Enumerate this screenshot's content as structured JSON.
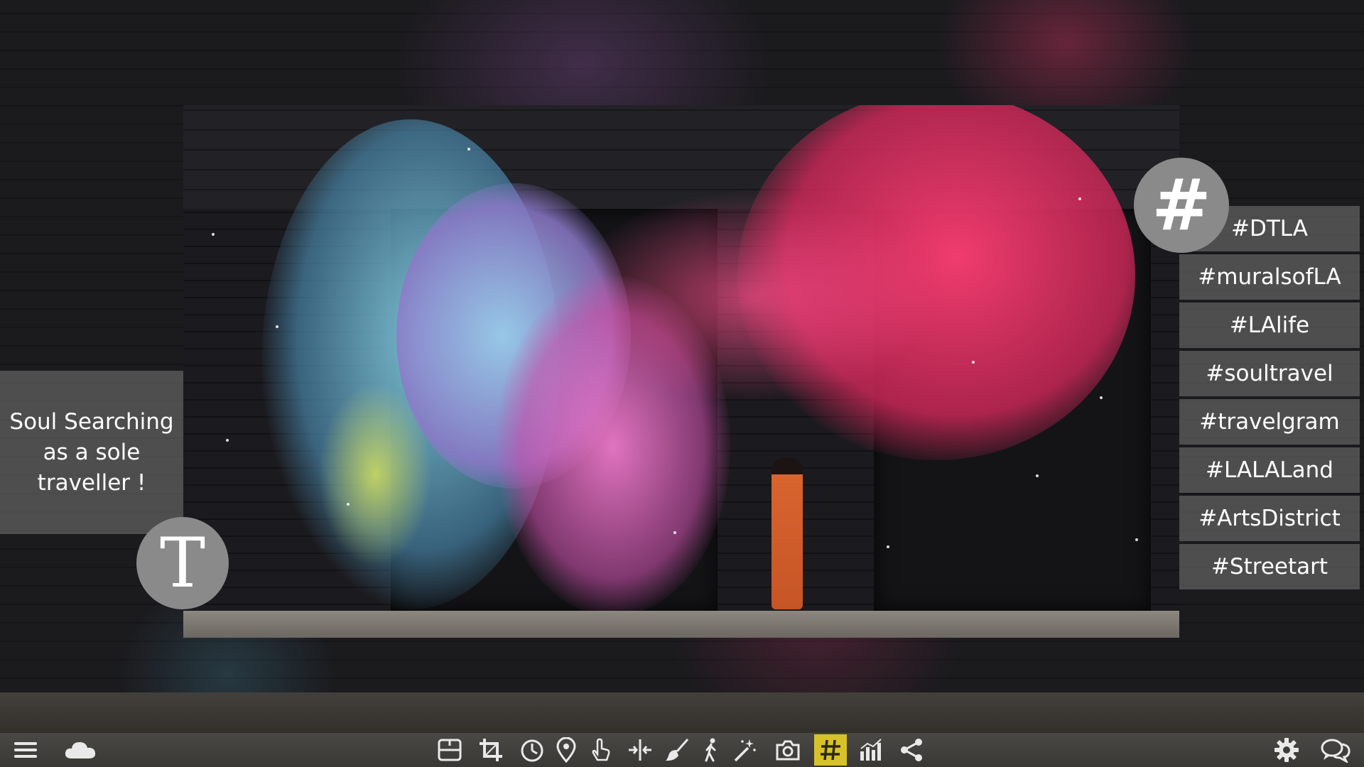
{
  "caption": {
    "line1": "Soul Searching",
    "line2": "as a sole",
    "line3": "traveller !"
  },
  "text_tool": {
    "glyph": "T",
    "icon": "text-tool-icon"
  },
  "hashtag_badge": {
    "glyph": "#",
    "icon": "hashtag-icon"
  },
  "hashtags": [
    "#DTLA",
    "#muralsofLA",
    "#LAlife",
    "#soultravel",
    "#travelgram",
    "#LALALand",
    "#ArtsDistrict",
    "#Streetart"
  ],
  "toolbar": {
    "left": [
      "menu-icon",
      "cloud-icon"
    ],
    "center": [
      "layout-icon",
      "crop-icon",
      "timer-icon",
      "location-pin-icon",
      "touch-icon",
      "split-icon",
      "brush-icon",
      "walking-person-icon",
      "magic-wand-icon",
      "camera-icon",
      "hashtag-icon",
      "bar-chart-icon",
      "share-icon"
    ],
    "active": "hashtag-icon",
    "right": [
      "settings-icon",
      "chat-icon"
    ]
  },
  "colors": {
    "toolbar_bg": "#3f3d3a",
    "active_accent": "#d7c22a",
    "panel_bg": "rgba(120,120,120,0.55)",
    "badge_bg": "#8a8a8a"
  }
}
